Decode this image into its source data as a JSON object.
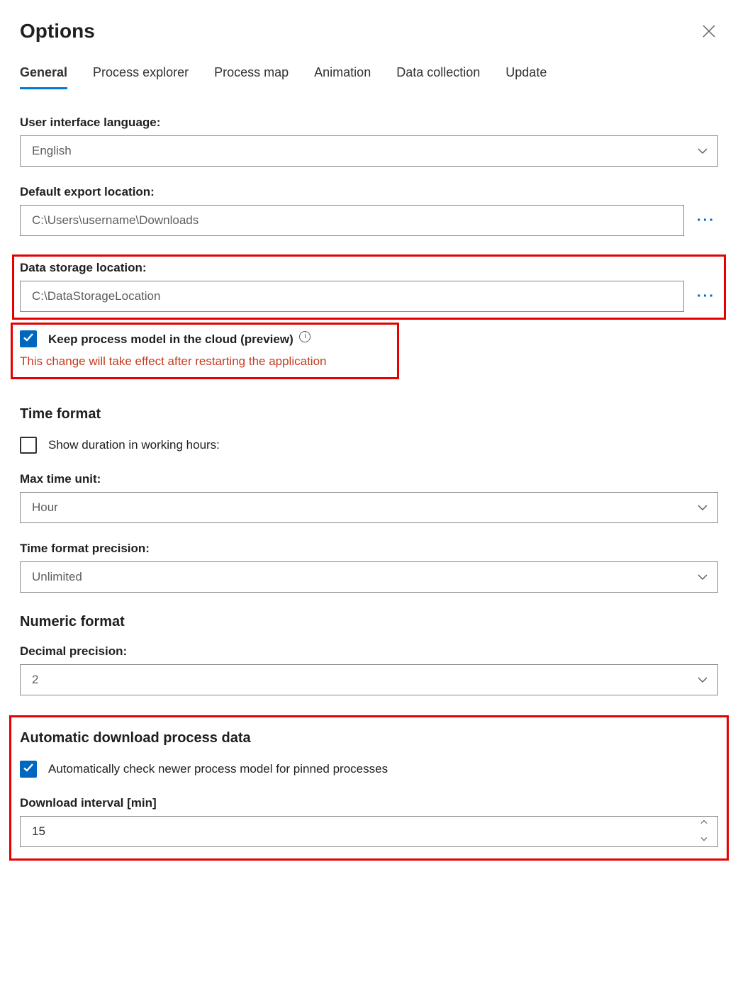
{
  "title": "Options",
  "tabs": [
    "General",
    "Process explorer",
    "Process map",
    "Animation",
    "Data collection",
    "Update"
  ],
  "activeTab": 0,
  "language": {
    "label": "User interface language:",
    "value": "English"
  },
  "exportLocation": {
    "label": "Default export location:",
    "value": "C:\\Users\\username\\Downloads"
  },
  "dataStorage": {
    "label": "Data storage location:",
    "value": "C:\\DataStorageLocation"
  },
  "keepCloud": {
    "label": "Keep process model in the cloud (preview)",
    "checked": true,
    "warning": "This change will take effect after restarting the application"
  },
  "timeFormat": {
    "heading": "Time format",
    "showDuration": {
      "label": "Show duration in working hours:",
      "checked": false
    },
    "maxTimeUnit": {
      "label": "Max time unit:",
      "value": "Hour"
    },
    "precision": {
      "label": "Time format precision:",
      "value": "Unlimited"
    }
  },
  "numericFormat": {
    "heading": "Numeric format",
    "decimalPrecision": {
      "label": "Decimal precision:",
      "value": "2"
    }
  },
  "autoDownload": {
    "heading": "Automatic download process data",
    "check": {
      "label": "Automatically check newer process model for pinned processes",
      "checked": true
    },
    "interval": {
      "label": "Download interval [min]",
      "value": "15"
    }
  }
}
